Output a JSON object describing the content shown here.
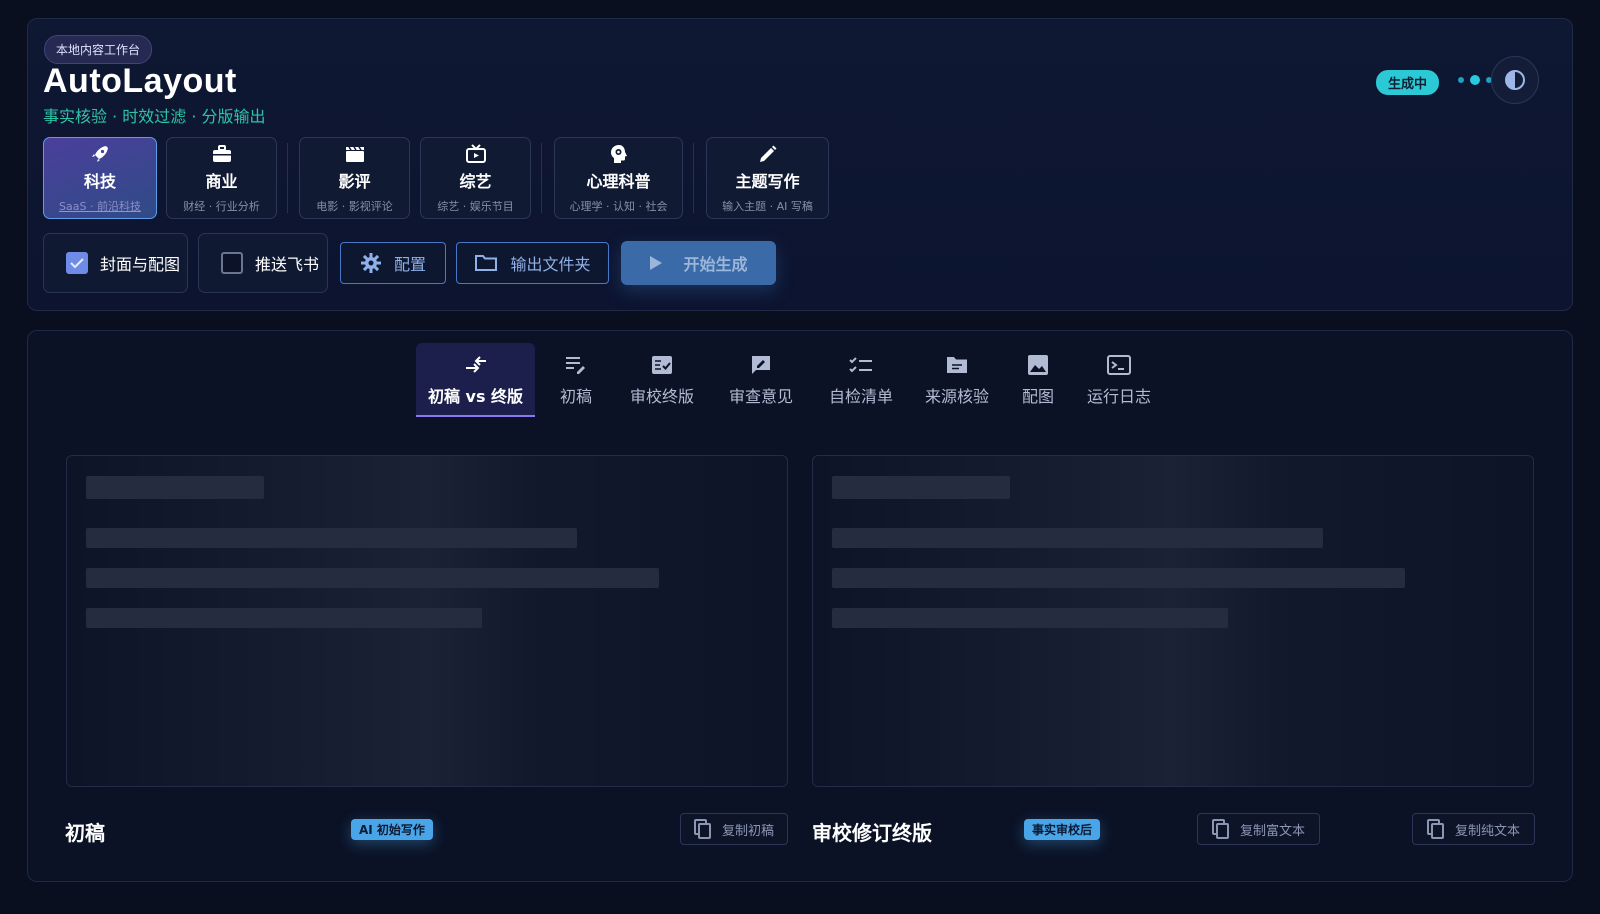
{
  "header": {
    "badge": "本地内容工作台",
    "title": "AutoLayout",
    "subtitle": "事实核验 · 时效过滤 · 分版输出",
    "status": "生成中"
  },
  "categories": [
    {
      "name": "科技",
      "desc": "SaaS · 前沿科技",
      "icon": "rocket-icon",
      "active": true
    },
    {
      "name": "商业",
      "desc": "财经 · 行业分析",
      "icon": "briefcase-icon"
    },
    {
      "name": "影评",
      "desc": "电影 · 影视评论",
      "icon": "clapperboard-icon"
    },
    {
      "name": "综艺",
      "desc": "综艺 · 娱乐节目",
      "icon": "tv-icon"
    },
    {
      "name": "心理科普",
      "desc": "心理学 · 认知 · 社会",
      "icon": "brain-head-icon"
    },
    {
      "name": "主题写作",
      "desc": "输入主题 · AI 写稿",
      "icon": "pencil-icon"
    }
  ],
  "options": {
    "cover_label": "封面与配图",
    "cover_checked": true,
    "feishu_label": "推送飞书",
    "feishu_checked": false,
    "config_label": "配置",
    "output_label": "输出文件夹",
    "start_label": "开始生成"
  },
  "tabs": [
    {
      "label": "初稿 vs 终版",
      "icon": "compare-arrows-icon",
      "active": true
    },
    {
      "label": "初稿",
      "icon": "draft-edit-icon"
    },
    {
      "label": "审校终版",
      "icon": "checked-doc-icon"
    },
    {
      "label": "审查意见",
      "icon": "comment-pen-icon"
    },
    {
      "label": "自检清单",
      "icon": "checklist-icon"
    },
    {
      "label": "来源核验",
      "icon": "folder-icon"
    },
    {
      "label": "配图",
      "icon": "image-icon"
    },
    {
      "label": "运行日志",
      "icon": "terminal-icon"
    }
  ],
  "left_doc": {
    "title": "初稿",
    "tag": "AI 初始写作",
    "copy_label": "复制初稿"
  },
  "right_doc": {
    "title": "审校修订终版",
    "tag": "事实审校后",
    "copy_rich_label": "复制富文本",
    "copy_plain_label": "复制纯文本"
  },
  "colors": {
    "background": "#0a0f1f",
    "accent_teal": "#2fc3a7",
    "status_cyan": "#2bc9d6",
    "primary_blue": "#3a6aa8",
    "tab_underline": "#8a78f0"
  }
}
